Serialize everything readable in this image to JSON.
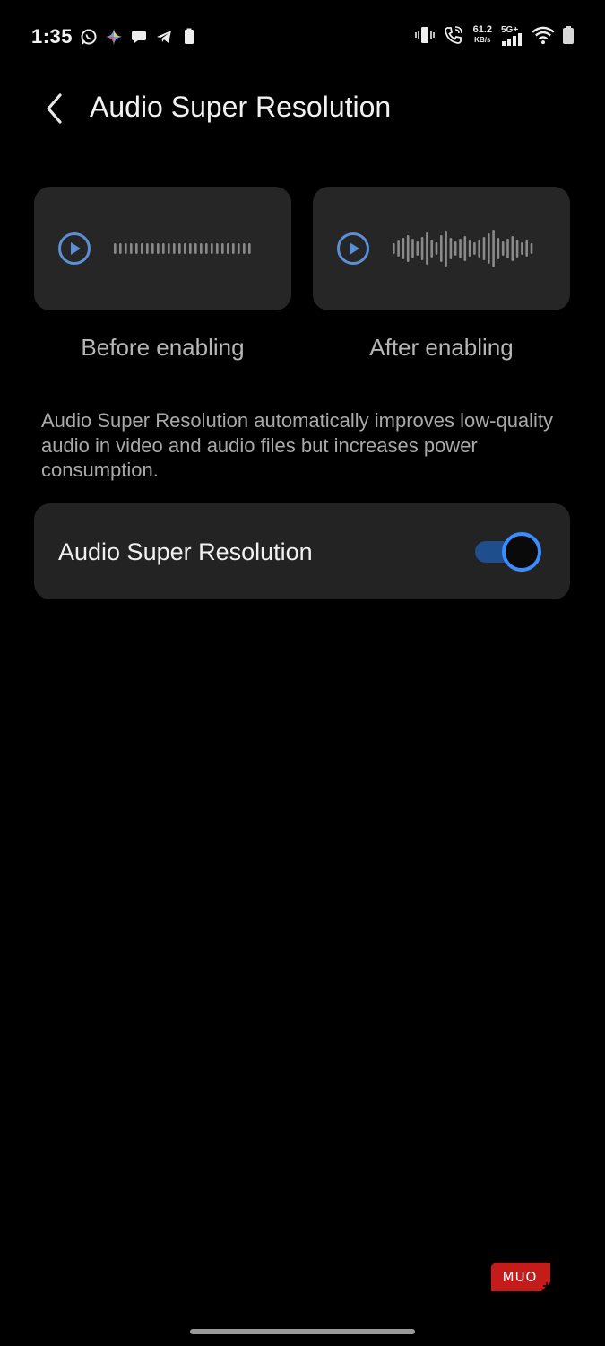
{
  "status_bar": {
    "time": "1:35",
    "net_speed_value": "61.2",
    "net_speed_unit": "KB/s",
    "network_type": "5G+",
    "left_icons": [
      "whatsapp-icon",
      "gemini-icon",
      "chat-bubble-icon",
      "telegram-icon",
      "battery-small-icon"
    ],
    "right_icons": [
      "vibrate-icon",
      "wifi-calling-icon",
      "signal-icon",
      "wifi-icon",
      "battery-icon"
    ]
  },
  "header": {
    "title": "Audio Super Resolution",
    "back_icon": "chevron-left-icon"
  },
  "samples": {
    "before": {
      "label": "Before enabling",
      "icon": "play-icon"
    },
    "after": {
      "label": "After enabling",
      "icon": "play-icon"
    }
  },
  "description": "Audio Super Resolution automatically improves low-quality audio in video and audio files but increases power consumption.",
  "setting": {
    "label": "Audio Super Resolution",
    "enabled": true
  },
  "watermark": "MUO",
  "colors": {
    "background": "#000000",
    "card": "#262626",
    "accent": "#3a8dff",
    "play_icon": "#5b8fd6",
    "muted_text": "#a9a9a9"
  }
}
